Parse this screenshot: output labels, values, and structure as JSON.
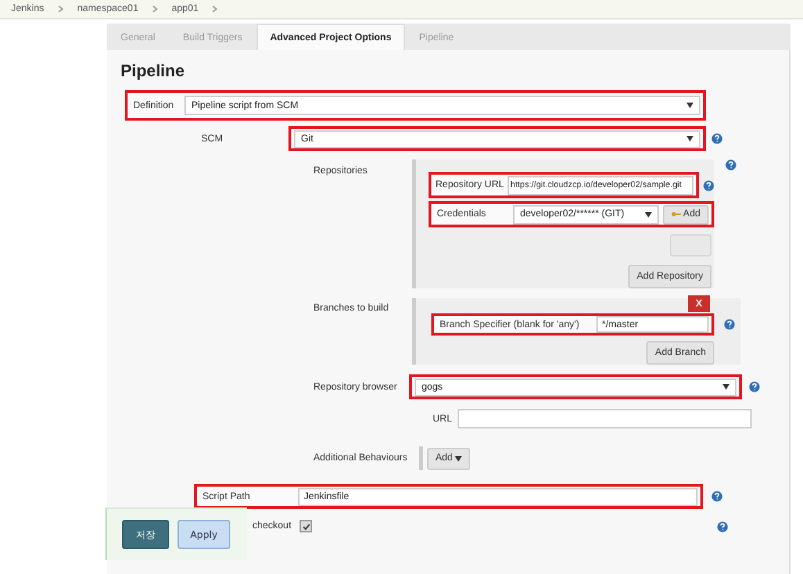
{
  "breadcrumbs": [
    "Jenkins",
    "namespace01",
    "app01"
  ],
  "tabs": [
    {
      "label": "General",
      "selected": false
    },
    {
      "label": "Build Triggers",
      "selected": false
    },
    {
      "label": "Advanced Project Options",
      "selected": true
    },
    {
      "label": "Pipeline",
      "selected": false
    }
  ],
  "section_title": "Pipeline",
  "definition": {
    "label": "Definition",
    "value": "Pipeline script from SCM"
  },
  "scm": {
    "label": "SCM",
    "value": "Git"
  },
  "repositories": {
    "label": "Repositories",
    "url_label": "Repository URL",
    "url": "https://git.cloudzcp.io/developer02/sample.git",
    "credentials_label": "Credentials",
    "credentials": "developer02/****** (GIT)",
    "add_button": "Add",
    "add_repository": "Add Repository"
  },
  "branches": {
    "label": "Branches to build",
    "delete": "X",
    "specifier_label": "Branch Specifier (blank for 'any')",
    "specifier": "*/master",
    "add_branch": "Add Branch"
  },
  "repository_browser": {
    "label": "Repository browser",
    "value": "gogs",
    "url_label": "URL"
  },
  "additional_behaviours": {
    "label": "Additional Behaviours",
    "button": "Add"
  },
  "script_path": {
    "label": "Script Path",
    "value": "Jenkinsfile"
  },
  "lightweight_checkout": {
    "label": "checkout",
    "checked": true
  },
  "buttons": [
    "저장",
    "Apply"
  ]
}
